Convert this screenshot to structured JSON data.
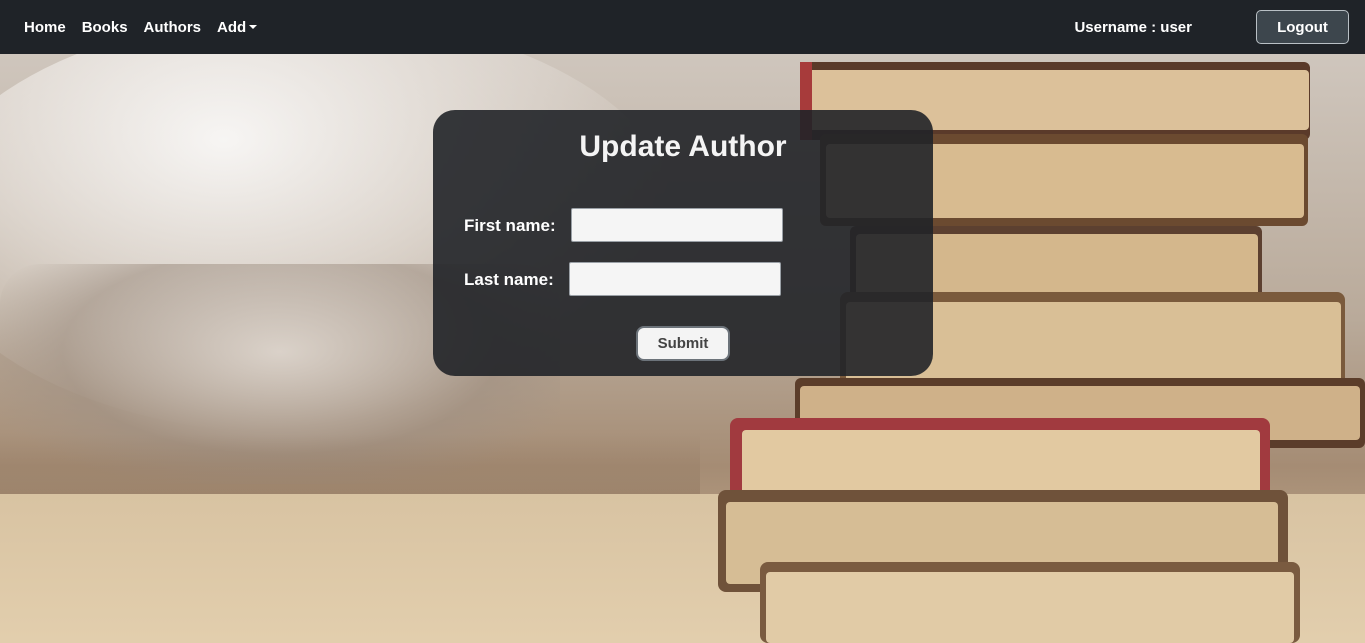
{
  "nav": {
    "items": [
      {
        "label": "Home"
      },
      {
        "label": "Books"
      },
      {
        "label": "Authors"
      },
      {
        "label": "Add"
      }
    ],
    "username": "Username : user",
    "logout_label": "Logout"
  },
  "form": {
    "title": "Update Author",
    "first_name_label": "First name:",
    "first_name_value": "",
    "last_name_label": "Last name:",
    "last_name_value": "",
    "submit_label": "Submit"
  },
  "colors": {
    "navbar": "#1f2328",
    "panel": "#212428",
    "logout_button": "#3d464d"
  },
  "icons": {
    "add_dropdown": "caret-down-icon"
  }
}
